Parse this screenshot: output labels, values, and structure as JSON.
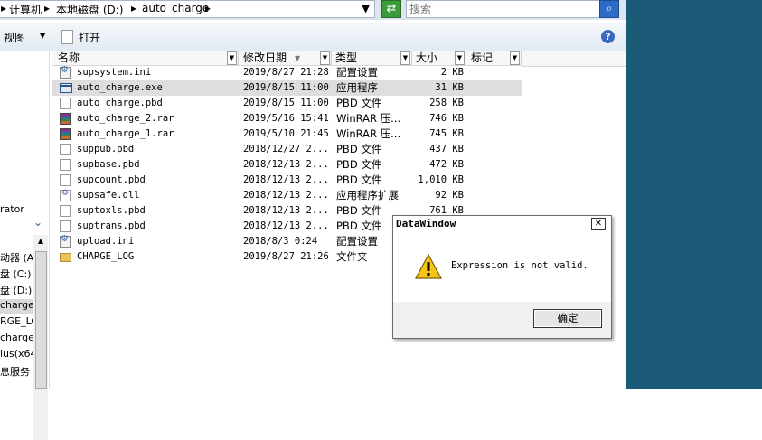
{
  "breadcrumb": {
    "sep": "▸",
    "items": [
      "计算机",
      "本地磁盘 (D:)",
      "auto_charge"
    ]
  },
  "search": {
    "placeholder": "搜索"
  },
  "toolbar": {
    "view_label": "视图",
    "open_label": "打开"
  },
  "nav": {
    "items": [
      {
        "label": "rator",
        "icon": ""
      },
      {
        "label": "动器 (A",
        "icon": ""
      },
      {
        "label": "盘 (C:)",
        "icon": ""
      },
      {
        "label": "盘 (D:)",
        "icon": ""
      },
      {
        "label": "charge",
        "icon": ""
      },
      {
        "label": "RGE_LOG",
        "icon": ""
      },
      {
        "label": "charge",
        "icon": ""
      },
      {
        "label": "lus(x64",
        "icon": ""
      },
      {
        "label": "息服务",
        "icon": ""
      }
    ]
  },
  "columns": {
    "name": "名称",
    "date": "修改日期",
    "type": "类型",
    "size": "大小",
    "tag": "标记"
  },
  "files": [
    {
      "name": "supsystem.ini",
      "date": "2019/8/27 21:28",
      "type": "配置设置",
      "size": "2 KB",
      "icon": "ini-icon"
    },
    {
      "name": "auto_charge.exe",
      "date": "2019/8/15 11:00",
      "type": "应用程序",
      "size": "31 KB",
      "icon": "exe-icon"
    },
    {
      "name": "auto_charge.pbd",
      "date": "2019/8/15 11:00",
      "type": "PBD 文件",
      "size": "258 KB",
      "icon": "file-icon"
    },
    {
      "name": "auto_charge_2.rar",
      "date": "2019/5/16 15:41",
      "type": "WinRAR 压...",
      "size": "746 KB",
      "icon": "rar-icon"
    },
    {
      "name": "auto_charge_1.rar",
      "date": "2019/5/10 21:45",
      "type": "WinRAR 压...",
      "size": "745 KB",
      "icon": "rar-icon"
    },
    {
      "name": "suppub.pbd",
      "date": "2018/12/27 2...",
      "type": "PBD 文件",
      "size": "437 KB",
      "icon": "file-icon"
    },
    {
      "name": "supbase.pbd",
      "date": "2018/12/13 2...",
      "type": "PBD 文件",
      "size": "472 KB",
      "icon": "file-icon"
    },
    {
      "name": "supcount.pbd",
      "date": "2018/12/13 2...",
      "type": "PBD 文件",
      "size": "1,010 KB",
      "icon": "file-icon"
    },
    {
      "name": "supsafe.dll",
      "date": "2018/12/13 2...",
      "type": "应用程序扩展",
      "size": "92 KB",
      "icon": "dll-icon"
    },
    {
      "name": "suptoxls.pbd",
      "date": "2018/12/13 2...",
      "type": "PBD 文件",
      "size": "761 KB",
      "icon": "file-icon"
    },
    {
      "name": "suptrans.pbd",
      "date": "2018/12/13 2...",
      "type": "PBD 文件",
      "size": "",
      "icon": "file-icon"
    },
    {
      "name": "upload.ini",
      "date": "2018/8/3 0:24",
      "type": "配置设置",
      "size": "",
      "icon": "ini-icon"
    },
    {
      "name": "CHARGE_LOG",
      "date": "2019/8/27 21:26",
      "type": "文件夹",
      "size": "",
      "icon": "folder-icon"
    }
  ],
  "selected_index": 1,
  "dialog": {
    "title": "DataWindow",
    "message": "Expression is not valid.",
    "ok_label": "确定",
    "close_glyph": "✕"
  },
  "colors": {
    "desktop": "#1b5b78",
    "selection": "#dedede"
  }
}
